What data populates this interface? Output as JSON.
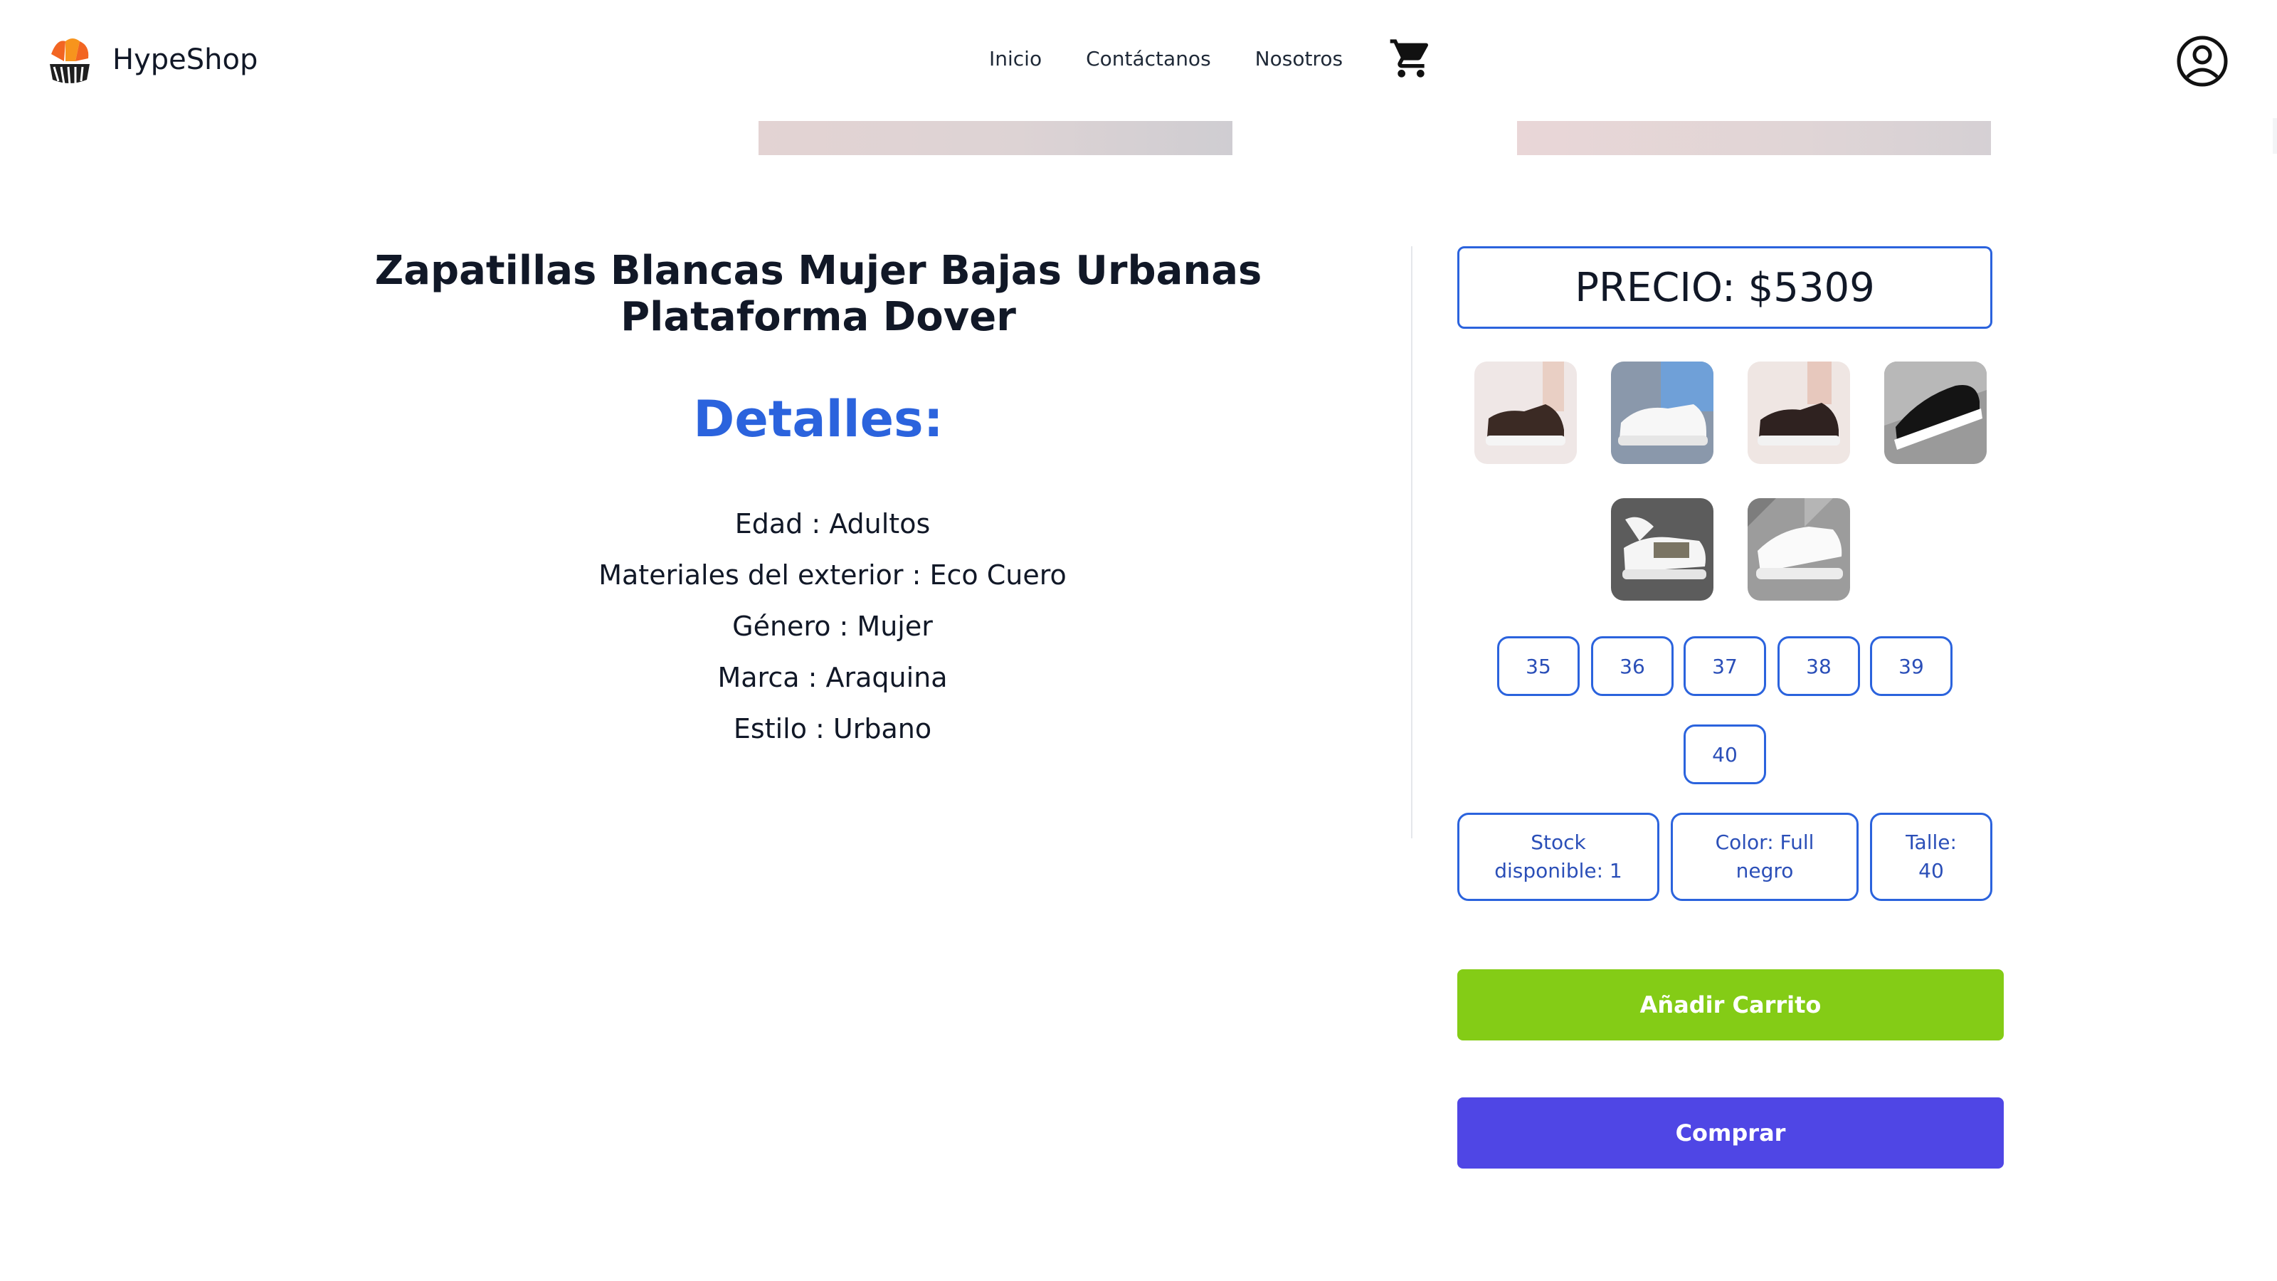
{
  "header": {
    "brand": "HypeShop",
    "logo_icon": "hypeshop-logo",
    "nav": [
      "Inicio",
      "Contáctanos",
      "Nosotros"
    ],
    "cart_icon": "shopping-cart-icon",
    "user_icon": "user-account-icon"
  },
  "product": {
    "title": "Zapatillas Blancas Mujer Bajas Urbanas Plataforma Dover",
    "details_heading": "Detalles:",
    "details": [
      "Edad : Adultos",
      "Materiales del exterior : Eco Cuero",
      "Género : Mujer",
      "Marca : Araquina",
      "Estilo : Urbano"
    ]
  },
  "purchase": {
    "price": "PRECIO: $5309",
    "thumbnails": [
      "brown-sneaker-thumbnail",
      "white-sneaker-jeans-thumbnail",
      "dark-brown-sneaker-thumbnail",
      "black-sneaker-thumbnail",
      "white-khaki-sneaker-thumbnail",
      "white-sneaker-street-thumbnail"
    ],
    "sizes": [
      "35",
      "36",
      "37",
      "38",
      "39",
      "40"
    ],
    "stock": {
      "line1": "Stock",
      "line2": "disponible: 1"
    },
    "color": {
      "line1": "Color: Full",
      "line2": "negro"
    },
    "size_selected": {
      "line1": "Talle:",
      "line2": "40"
    },
    "add_to_cart": "Añadir Carrito",
    "buy": "Comprar"
  },
  "colors": {
    "accent_blue": "#2b63dd",
    "add_green": "#84cc16",
    "buy_indigo": "#4f46e5"
  }
}
